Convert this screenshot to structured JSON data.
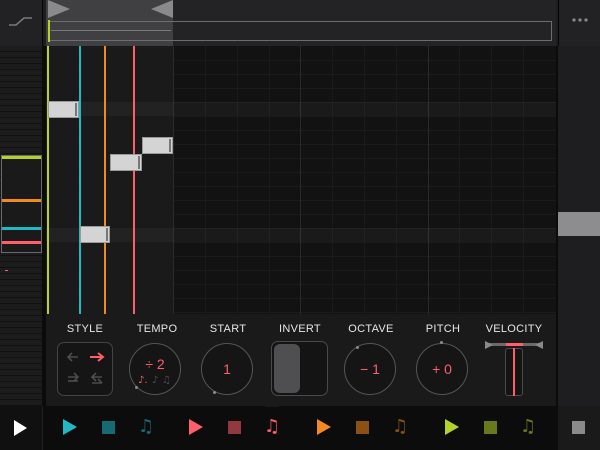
{
  "colors": {
    "track1": "#1fb8c4",
    "track2": "#ff5e6a",
    "track3": "#f38a1e",
    "track4": "#b4d32a",
    "accent": "#ff5e6a"
  },
  "icons": {
    "curve": "curve-icon",
    "more": "more-icon",
    "play": "play-icon",
    "stop": "stop-icon",
    "note": "music-note-icon"
  },
  "params": {
    "style": {
      "label": "STYLE"
    },
    "tempo": {
      "label": "TEMPO",
      "value": "÷ 2"
    },
    "start": {
      "label": "START",
      "value": "1"
    },
    "invert": {
      "label": "INVERT"
    },
    "octave": {
      "label": "OCTAVE",
      "value": "− 1"
    },
    "pitch": {
      "label": "PITCH",
      "value": "+ 0"
    },
    "velocity": {
      "label": "VELOCITY"
    }
  },
  "transport": {
    "tracks": [
      {
        "color": "#1fb8c4",
        "selected": false
      },
      {
        "color": "#ff5e6a",
        "selected": true
      },
      {
        "color": "#f38a1e",
        "selected": false
      },
      {
        "color": "#b4d32a",
        "selected": false
      }
    ]
  }
}
